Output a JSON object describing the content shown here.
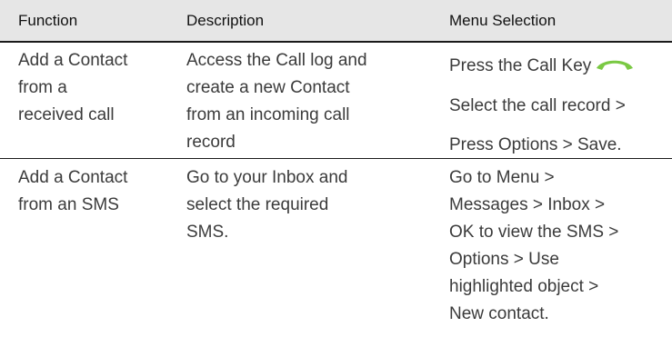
{
  "header": {
    "function": "Function",
    "description": "Description",
    "menu_selection": "Menu Selection"
  },
  "rows": [
    {
      "function": [
        "Add a Contact",
        "from a",
        "received call"
      ],
      "description": [
        "Access the Call log and",
        "create a new Contact",
        "from an incoming call",
        "record"
      ],
      "menu": [
        "Press the Call Key",
        "Select the call record >",
        "Press Options > Save."
      ]
    },
    {
      "function": [
        "Add a Contact",
        "from an SMS"
      ],
      "description": [
        "Go to your Inbox and",
        "select the required",
        "SMS."
      ],
      "menu": [
        "Go to Menu >",
        "Messages > Inbox >",
        "OK to view the SMS >",
        "Options > Use",
        "highlighted object >",
        "New contact."
      ]
    }
  ],
  "icons": {
    "call_key": "green-call-handset-icon",
    "call_key_color": "#7ac943"
  }
}
